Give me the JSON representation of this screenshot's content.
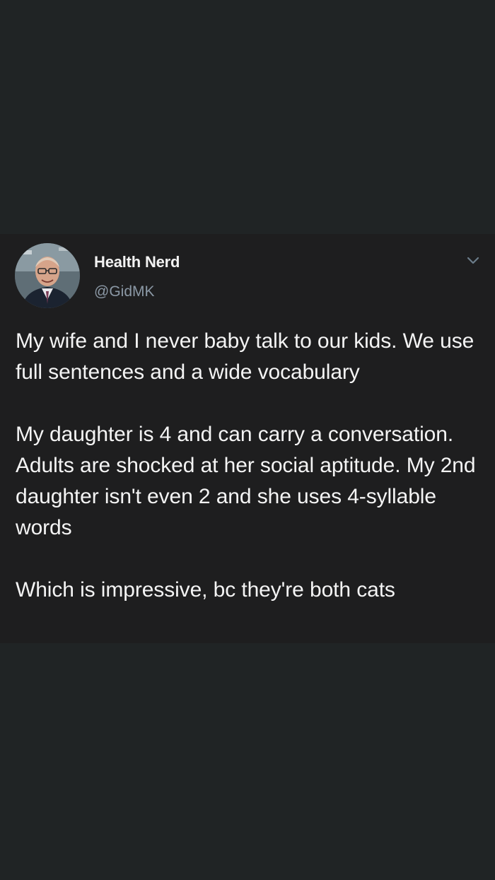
{
  "tweet": {
    "author": {
      "display_name": "Health Nerd",
      "handle": "@GidMK",
      "avatar_icon": "profile-photo"
    },
    "menu_icon": "chevron-down-icon",
    "paragraphs": [
      "My wife and I never baby talk to our kids. We use full sentences and a wide vocabulary",
      "My daughter is 4 and can carry a conversation. Adults are shocked at her social aptitude. My 2nd daughter isn't even 2 and she uses 4-syllable words",
      "Which is impressive, bc they're both cats"
    ]
  },
  "colors": {
    "page_background": "#202425",
    "card_background": "#1e1e1f",
    "text": "#f4f4f4",
    "secondary_text": "#8b98a5"
  }
}
